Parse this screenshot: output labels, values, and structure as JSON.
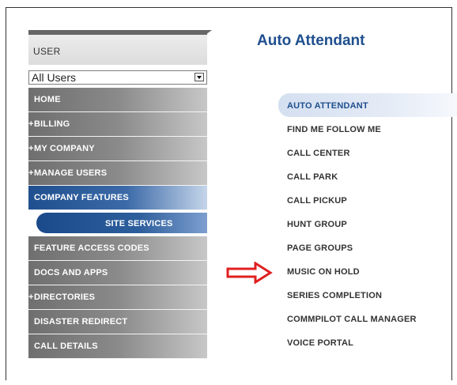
{
  "sidebar": {
    "user_label": "USER",
    "user_select_value": "All Users",
    "items": [
      {
        "label": "HOME",
        "has_marker": false
      },
      {
        "label": "BILLING",
        "has_marker": true
      },
      {
        "label": "MY COMPANY",
        "has_marker": true
      },
      {
        "label": "MANAGE USERS",
        "has_marker": true
      },
      {
        "label": "COMPANY FEATURES",
        "has_marker": false
      },
      {
        "label": "SITE SERVICES",
        "has_marker": false
      },
      {
        "label": "FEATURE ACCESS CODES",
        "has_marker": false
      },
      {
        "label": "DOCS AND APPS",
        "has_marker": false
      },
      {
        "label": "DIRECTORIES",
        "has_marker": true
      },
      {
        "label": "DISASTER REDIRECT",
        "has_marker": false
      },
      {
        "label": "CALL DETAILS",
        "has_marker": false
      }
    ],
    "marker_glyph": "+"
  },
  "main": {
    "title": "Auto Attendant",
    "features": [
      "AUTO ATTENDANT",
      "FIND ME FOLLOW ME",
      "CALL CENTER",
      "CALL PARK",
      "CALL PICKUP",
      "HUNT GROUP",
      "PAGE GROUPS",
      "MUSIC ON HOLD",
      "SERIES COMPLETION",
      "COMMPILOT CALL MANAGER",
      "VOICE PORTAL"
    ]
  },
  "annotation": {
    "icon": "red-arrow-right-icon",
    "color": "#e02020"
  },
  "colors": {
    "brand_blue": "#1f4f8e",
    "nav_gray": "#7d7d7d"
  }
}
